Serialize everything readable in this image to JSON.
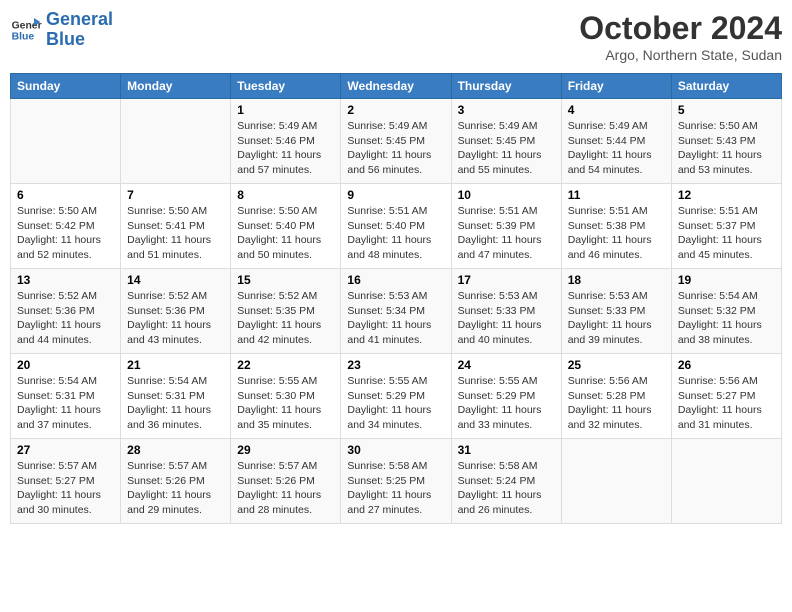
{
  "header": {
    "logo_general": "General",
    "logo_blue": "Blue",
    "month": "October 2024",
    "location": "Argo, Northern State, Sudan"
  },
  "days_of_week": [
    "Sunday",
    "Monday",
    "Tuesday",
    "Wednesday",
    "Thursday",
    "Friday",
    "Saturday"
  ],
  "weeks": [
    [
      {
        "day": "",
        "info": ""
      },
      {
        "day": "",
        "info": ""
      },
      {
        "day": "1",
        "info": "Sunrise: 5:49 AM\nSunset: 5:46 PM\nDaylight: 11 hours\nand 57 minutes."
      },
      {
        "day": "2",
        "info": "Sunrise: 5:49 AM\nSunset: 5:45 PM\nDaylight: 11 hours\nand 56 minutes."
      },
      {
        "day": "3",
        "info": "Sunrise: 5:49 AM\nSunset: 5:45 PM\nDaylight: 11 hours\nand 55 minutes."
      },
      {
        "day": "4",
        "info": "Sunrise: 5:49 AM\nSunset: 5:44 PM\nDaylight: 11 hours\nand 54 minutes."
      },
      {
        "day": "5",
        "info": "Sunrise: 5:50 AM\nSunset: 5:43 PM\nDaylight: 11 hours\nand 53 minutes."
      }
    ],
    [
      {
        "day": "6",
        "info": "Sunrise: 5:50 AM\nSunset: 5:42 PM\nDaylight: 11 hours\nand 52 minutes."
      },
      {
        "day": "7",
        "info": "Sunrise: 5:50 AM\nSunset: 5:41 PM\nDaylight: 11 hours\nand 51 minutes."
      },
      {
        "day": "8",
        "info": "Sunrise: 5:50 AM\nSunset: 5:40 PM\nDaylight: 11 hours\nand 50 minutes."
      },
      {
        "day": "9",
        "info": "Sunrise: 5:51 AM\nSunset: 5:40 PM\nDaylight: 11 hours\nand 48 minutes."
      },
      {
        "day": "10",
        "info": "Sunrise: 5:51 AM\nSunset: 5:39 PM\nDaylight: 11 hours\nand 47 minutes."
      },
      {
        "day": "11",
        "info": "Sunrise: 5:51 AM\nSunset: 5:38 PM\nDaylight: 11 hours\nand 46 minutes."
      },
      {
        "day": "12",
        "info": "Sunrise: 5:51 AM\nSunset: 5:37 PM\nDaylight: 11 hours\nand 45 minutes."
      }
    ],
    [
      {
        "day": "13",
        "info": "Sunrise: 5:52 AM\nSunset: 5:36 PM\nDaylight: 11 hours\nand 44 minutes."
      },
      {
        "day": "14",
        "info": "Sunrise: 5:52 AM\nSunset: 5:36 PM\nDaylight: 11 hours\nand 43 minutes."
      },
      {
        "day": "15",
        "info": "Sunrise: 5:52 AM\nSunset: 5:35 PM\nDaylight: 11 hours\nand 42 minutes."
      },
      {
        "day": "16",
        "info": "Sunrise: 5:53 AM\nSunset: 5:34 PM\nDaylight: 11 hours\nand 41 minutes."
      },
      {
        "day": "17",
        "info": "Sunrise: 5:53 AM\nSunset: 5:33 PM\nDaylight: 11 hours\nand 40 minutes."
      },
      {
        "day": "18",
        "info": "Sunrise: 5:53 AM\nSunset: 5:33 PM\nDaylight: 11 hours\nand 39 minutes."
      },
      {
        "day": "19",
        "info": "Sunrise: 5:54 AM\nSunset: 5:32 PM\nDaylight: 11 hours\nand 38 minutes."
      }
    ],
    [
      {
        "day": "20",
        "info": "Sunrise: 5:54 AM\nSunset: 5:31 PM\nDaylight: 11 hours\nand 37 minutes."
      },
      {
        "day": "21",
        "info": "Sunrise: 5:54 AM\nSunset: 5:31 PM\nDaylight: 11 hours\nand 36 minutes."
      },
      {
        "day": "22",
        "info": "Sunrise: 5:55 AM\nSunset: 5:30 PM\nDaylight: 11 hours\nand 35 minutes."
      },
      {
        "day": "23",
        "info": "Sunrise: 5:55 AM\nSunset: 5:29 PM\nDaylight: 11 hours\nand 34 minutes."
      },
      {
        "day": "24",
        "info": "Sunrise: 5:55 AM\nSunset: 5:29 PM\nDaylight: 11 hours\nand 33 minutes."
      },
      {
        "day": "25",
        "info": "Sunrise: 5:56 AM\nSunset: 5:28 PM\nDaylight: 11 hours\nand 32 minutes."
      },
      {
        "day": "26",
        "info": "Sunrise: 5:56 AM\nSunset: 5:27 PM\nDaylight: 11 hours\nand 31 minutes."
      }
    ],
    [
      {
        "day": "27",
        "info": "Sunrise: 5:57 AM\nSunset: 5:27 PM\nDaylight: 11 hours\nand 30 minutes."
      },
      {
        "day": "28",
        "info": "Sunrise: 5:57 AM\nSunset: 5:26 PM\nDaylight: 11 hours\nand 29 minutes."
      },
      {
        "day": "29",
        "info": "Sunrise: 5:57 AM\nSunset: 5:26 PM\nDaylight: 11 hours\nand 28 minutes."
      },
      {
        "day": "30",
        "info": "Sunrise: 5:58 AM\nSunset: 5:25 PM\nDaylight: 11 hours\nand 27 minutes."
      },
      {
        "day": "31",
        "info": "Sunrise: 5:58 AM\nSunset: 5:24 PM\nDaylight: 11 hours\nand 26 minutes."
      },
      {
        "day": "",
        "info": ""
      },
      {
        "day": "",
        "info": ""
      }
    ]
  ]
}
